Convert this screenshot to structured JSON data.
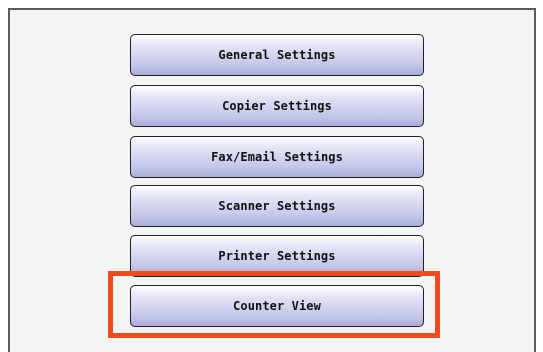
{
  "menu": {
    "items": [
      {
        "label": "General Settings"
      },
      {
        "label": "Copier Settings"
      },
      {
        "label": "Fax/Email Settings"
      },
      {
        "label": "Scanner Settings"
      },
      {
        "label": "Printer Settings"
      },
      {
        "label": "Counter View"
      }
    ]
  },
  "colors": {
    "highlight": "#f04a1e",
    "button_top": "#ffffff",
    "button_bottom": "#a9acd9",
    "panel_background": "#f4f4f4"
  },
  "highlighted_item": "Counter View"
}
